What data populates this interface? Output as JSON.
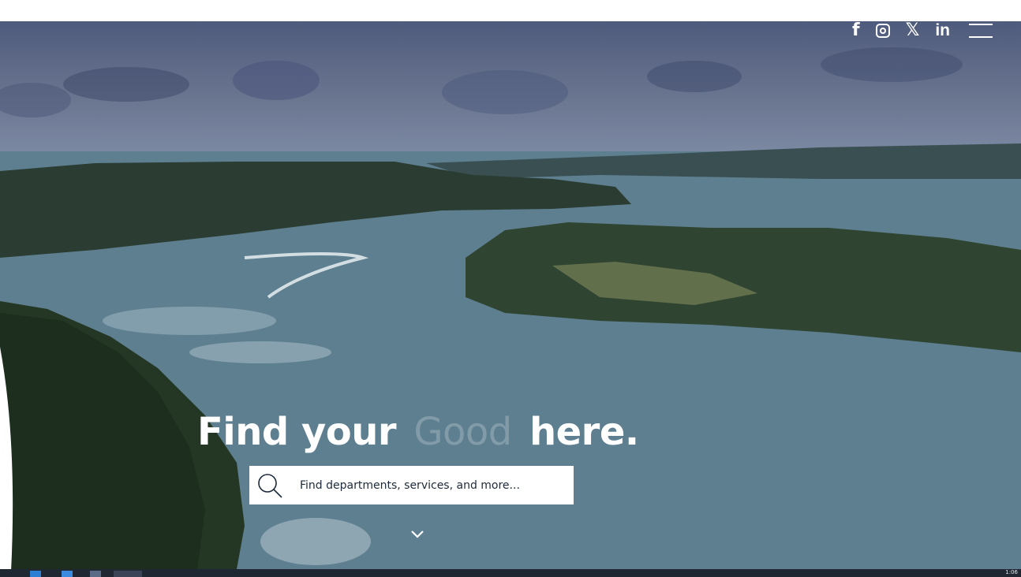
{
  "social": {
    "facebook": {
      "glyph": "f",
      "icon": "facebook-icon"
    },
    "instagram": {
      "icon": "instagram-icon"
    },
    "x": {
      "glyph": "𝕏",
      "icon": "x-icon"
    },
    "linkedin": {
      "glyph": "in",
      "icon": "linkedin-icon"
    }
  },
  "hero": {
    "headline_start": "Find your",
    "headline_faded": "Good",
    "headline_end": "here."
  },
  "search": {
    "placeholder": "Find departments, services, and more..."
  },
  "taskbar": {
    "clock": "1:06"
  },
  "colors": {
    "search_text": "#1d2a3a",
    "taskbar": "#1f2733"
  }
}
